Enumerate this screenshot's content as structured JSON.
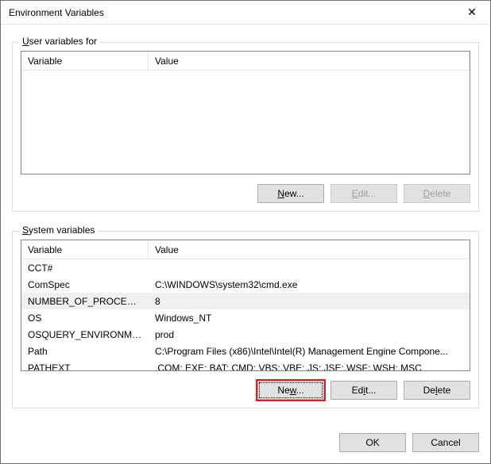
{
  "window": {
    "title": "Environment Variables"
  },
  "user_section": {
    "label_prefix": "U",
    "label_rest": "ser variables for",
    "columns": {
      "variable": "Variable",
      "value": "Value"
    },
    "rows": [],
    "buttons": {
      "new": "New...",
      "edit": "Edit...",
      "delete": "Delete"
    }
  },
  "system_section": {
    "label_prefix": "S",
    "label_rest": "ystem variables",
    "columns": {
      "variable": "Variable",
      "value": "Value"
    },
    "rows": [
      {
        "variable": "CCT#",
        "value": ""
      },
      {
        "variable": "ComSpec",
        "value": "C:\\WINDOWS\\system32\\cmd.exe"
      },
      {
        "variable": "NUMBER_OF_PROCESSORS",
        "value": "8",
        "selected": true
      },
      {
        "variable": "OS",
        "value": "Windows_NT"
      },
      {
        "variable": "OSQUERY_ENVIRONMENT",
        "value": "prod"
      },
      {
        "variable": "Path",
        "value": "C:\\Program Files (x86)\\Intel\\Intel(R) Management Engine Compone..."
      },
      {
        "variable": "PATHEXT",
        "value": ".COM;.EXE;.BAT;.CMD;.VBS;.VBE;.JS;.JSE;.WSF;.WSH;.MSC"
      }
    ],
    "buttons": {
      "new_prefix": "Ne",
      "new_ul": "w",
      "new_suffix": "...",
      "edit_prefix": "Ed",
      "edit_ul": "i",
      "edit_suffix": "t...",
      "delete_prefix": "De",
      "delete_ul": "l",
      "delete_suffix": "ete"
    }
  },
  "dialog_buttons": {
    "ok": "OK",
    "cancel": "Cancel"
  }
}
